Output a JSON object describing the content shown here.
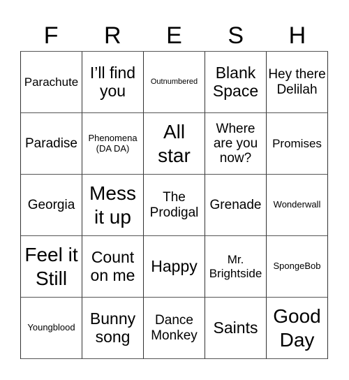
{
  "title_letters": [
    "F",
    "R",
    "E",
    "S",
    "H"
  ],
  "cells": [
    {
      "text": "Parachute",
      "size": "m"
    },
    {
      "text": "I’ll find you",
      "size": "l"
    },
    {
      "text": "Outnumbered",
      "size": "xs"
    },
    {
      "text": "Blank Space",
      "size": "l"
    },
    {
      "text": "Hey there Delilah",
      "size": "ml"
    },
    {
      "text": "Paradise",
      "size": "ml"
    },
    {
      "text": "Phenomena (DA DA)",
      "size": "s"
    },
    {
      "text": "All star",
      "size": "xl"
    },
    {
      "text": "Where are you now?",
      "size": "ml"
    },
    {
      "text": "Promises",
      "size": "m"
    },
    {
      "text": "Georgia",
      "size": "ml"
    },
    {
      "text": "Mess it up",
      "size": "xl"
    },
    {
      "text": "The Prodigal",
      "size": "ml"
    },
    {
      "text": "Grenade",
      "size": "ml"
    },
    {
      "text": "Wonderwall",
      "size": "s"
    },
    {
      "text": "Feel it Still",
      "size": "xl"
    },
    {
      "text": "Count on me",
      "size": "l"
    },
    {
      "text": "Happy",
      "size": "l"
    },
    {
      "text": "Mr. Brightside",
      "size": "m"
    },
    {
      "text": "SpongeBob",
      "size": "s"
    },
    {
      "text": "Youngblood",
      "size": "s"
    },
    {
      "text": "Bunny song",
      "size": "l"
    },
    {
      "text": "Dance Monkey",
      "size": "ml"
    },
    {
      "text": "Saints",
      "size": "l"
    },
    {
      "text": "Good Day",
      "size": "xl"
    }
  ]
}
